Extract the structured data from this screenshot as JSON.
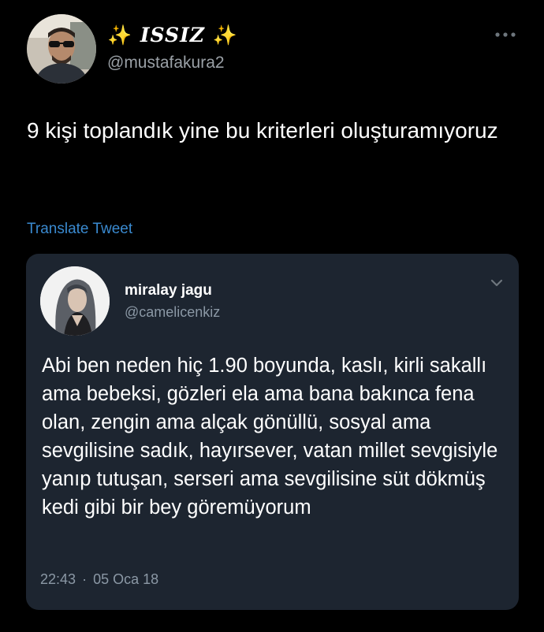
{
  "tweet": {
    "author": {
      "spark_left": "✨",
      "display_name": "ISSIZ",
      "spark_right": "✨",
      "handle": "@mustafakura2",
      "avatar_icon": "profile-photo-man-sunglasses"
    },
    "more_icon": "ellipsis-horizontal-icon",
    "text": "9 kişi toplandık yine bu kriterleri oluşturamıyoruz",
    "translate_label": "Translate Tweet"
  },
  "quoted": {
    "name": "miralay jagu",
    "handle": "@camelicenkiz",
    "avatar_icon": "profile-photo-woman",
    "menu_icon": "chevron-down-icon",
    "text": "Abi ben neden hiç 1.90 boyunda, kaslı, kirli sakallı ama bebeksi, gözleri ela ama bana bakınca fena olan, zengin ama alçak gönüllü, sosyal ama sevgilisine sadık, hayırsever, vatan millet sevgisiyle yanıp tutuşan, serseri ama sevgilisine süt dökmüş kedi gibi bir bey göremüyorum",
    "time": "22:43",
    "separator": "·",
    "date": "05 Oca 18"
  },
  "colors": {
    "background": "#000000",
    "card": "#1d2530",
    "link": "#3a8ad0",
    "secondary_text": "#8b98a5",
    "sparkle": "#f7c744"
  }
}
